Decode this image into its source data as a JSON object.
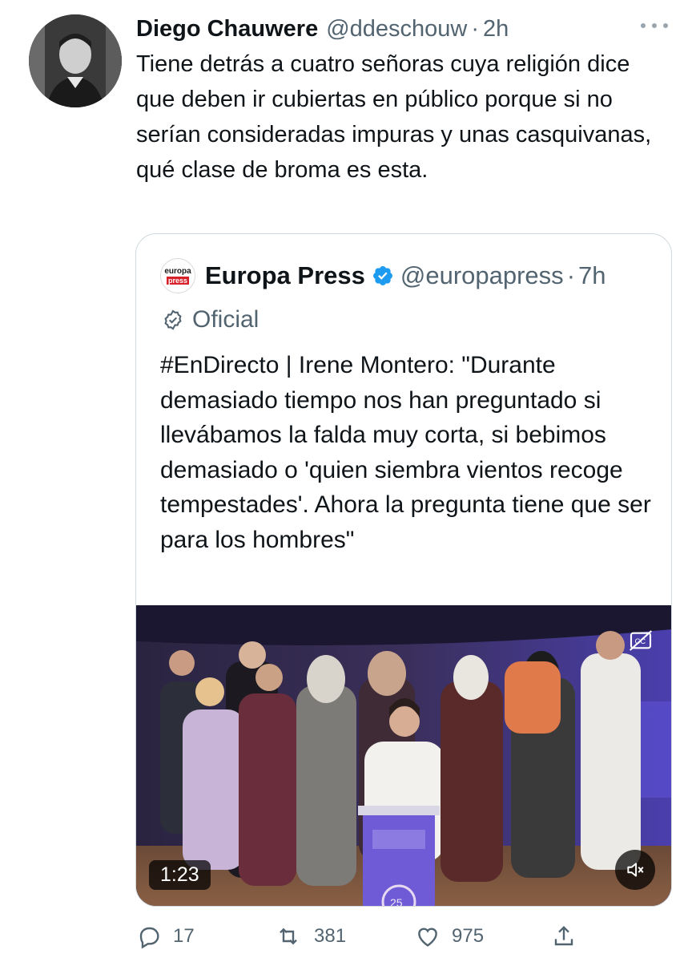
{
  "tweet": {
    "author_name": "Diego Chauwere",
    "author_handle": "@ddeschouw",
    "separator": "·",
    "time": "2h",
    "text": "Tiene detrás a cuatro señoras cuya religión dice que deben ir cubiertas en público porque si no serían consideradas impuras y unas casquivanas, qué clase de broma es esta."
  },
  "quote": {
    "avatar_line1": "europa",
    "avatar_line2": "press",
    "author_name": "Europa Press",
    "author_handle": "@europapress",
    "separator": "·",
    "time": "7h",
    "label": "Oficial",
    "text": "#EnDirecto | Irene Montero: \"Durante demasiado tiempo nos han preguntado si llevábamos la falda muy corta, si bebimos demasiado o 'quien siembra vientos recoge tempestades'. Ahora la pregunta tiene que ser para los hombres\"",
    "video": {
      "duration": "1:23",
      "podium_number": "25"
    }
  },
  "actions": {
    "reply_count": "17",
    "retweet_count": "381",
    "like_count": "975"
  },
  "colors": {
    "verified": "#1d9bf0",
    "secondary_text": "#536471",
    "border": "#cfd9de"
  },
  "icons": [
    "more-icon",
    "verified-icon",
    "official-badge-icon",
    "cc-icon",
    "mute-icon",
    "reply-icon",
    "retweet-icon",
    "like-icon",
    "share-icon"
  ]
}
